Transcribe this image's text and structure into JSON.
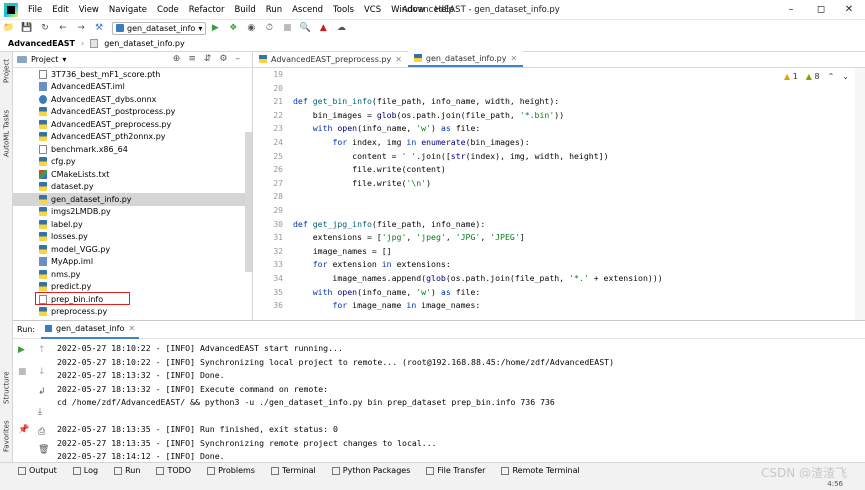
{
  "menu": [
    "File",
    "Edit",
    "View",
    "Navigate",
    "Code",
    "Refactor",
    "Build",
    "Run",
    "Ascend",
    "Tools",
    "VCS",
    "Window",
    "Help"
  ],
  "window_title": "AdvancedEAST - gen_dataset_info.py",
  "toolbar": {
    "run_config": "gen_dataset_info"
  },
  "breadcrumb": {
    "root": "AdvancedEAST",
    "file": "gen_dataset_info.py"
  },
  "left_strip": {
    "project": "Project",
    "automl": "AutoML Tasks",
    "structure": "Structure",
    "favorites": "Favorites"
  },
  "project_panel": {
    "title": "Project",
    "files": [
      {
        "name": "3T736_best_mF1_score.pth",
        "icon": "file"
      },
      {
        "name": "AdvancedEAST.iml",
        "icon": "iml"
      },
      {
        "name": "AdvancedEAST_dybs.onnx",
        "icon": "onnx"
      },
      {
        "name": "AdvancedEAST_postprocess.py",
        "icon": "py"
      },
      {
        "name": "AdvancedEAST_preprocess.py",
        "icon": "py"
      },
      {
        "name": "AdvancedEAST_pth2onnx.py",
        "icon": "py"
      },
      {
        "name": "benchmark.x86_64",
        "icon": "file"
      },
      {
        "name": "cfg.py",
        "icon": "py"
      },
      {
        "name": "CMakeLists.txt",
        "icon": "cmake"
      },
      {
        "name": "dataset.py",
        "icon": "py"
      },
      {
        "name": "gen_dataset_info.py",
        "icon": "py",
        "selected": true
      },
      {
        "name": "imgs2LMDB.py",
        "icon": "py"
      },
      {
        "name": "label.py",
        "icon": "py"
      },
      {
        "name": "losses.py",
        "icon": "py"
      },
      {
        "name": "model_VGG.py",
        "icon": "py"
      },
      {
        "name": "MyApp.iml",
        "icon": "iml"
      },
      {
        "name": "nms.py",
        "icon": "py"
      },
      {
        "name": "predict.py",
        "icon": "py"
      },
      {
        "name": "prep_bin.info",
        "icon": "file",
        "highlighted": true
      },
      {
        "name": "preprocess.py",
        "icon": "py"
      }
    ]
  },
  "editor": {
    "tabs": [
      {
        "label": "AdvancedEAST_preprocess.py",
        "active": false
      },
      {
        "label": "gen_dataset_info.py",
        "active": true
      }
    ],
    "inspections": {
      "warnings": "1",
      "weak_warnings": "8"
    },
    "line_numbers": [
      "19",
      "20",
      "21",
      "22",
      "23",
      "24",
      "25",
      "26",
      "27",
      "28",
      "29",
      "30",
      "31",
      "32",
      "33",
      "34",
      "35",
      "36"
    ],
    "code_lines": [
      "",
      "",
      "def get_bin_info(file_path, info_name, width, height):",
      "    bin_images = glob(os.path.join(file_path, '*.bin'))",
      "    with open(info_name, 'w') as file:",
      "        for index, img in enumerate(bin_images):",
      "            content = ' '.join([str(index), img, width, height])",
      "            file.write(content)",
      "            file.write('\\n')",
      "",
      "",
      "def get_jpg_info(file_path, info_name):",
      "    extensions = ['jpg', 'jpeg', 'JPG', 'JPEG']",
      "    image_names = []",
      "    for extension in extensions:",
      "        image_names.append(glob(os.path.join(file_path, '*.' + extension)))",
      "    with open(info_name, 'w') as file:",
      "        for image_name in image_names:"
    ]
  },
  "run_panel": {
    "label": "Run:",
    "tab": "gen_dataset_info",
    "console": [
      "2022-05-27 18:10:22 - [INFO] AdvancedEAST start running...",
      "2022-05-27 18:10:22 - [INFO] Synchronizing local project to remote... (root@192.168.88.45:/home/zdf/AdvancedEAST)",
      "2022-05-27 18:13:32 - [INFO] Done.",
      "2022-05-27 18:13:32 - [INFO] Execute command on remote:",
      "cd /home/zdf/AdvancedEAST/ && python3 -u ./gen_dataset_info.py bin prep_dataset prep_bin.info 736 736",
      "",
      "2022-05-27 18:13:35 - [INFO] Run finished, exit status: 0",
      "2022-05-27 18:13:35 - [INFO] Synchronizing remote project changes to local...",
      "2022-05-27 18:14:12 - [INFO] Done."
    ]
  },
  "bottom_tools": [
    "Output",
    "Log",
    "Run",
    "TODO",
    "Problems",
    "Terminal",
    "Python Packages",
    "File Transfer",
    "Remote Terminal"
  ],
  "status": {
    "event_log": "Event Log",
    "position": "4:56"
  },
  "watermark": "CSDN @渣渣飞",
  "colors": {
    "accent": "#4083c9",
    "highlight_box": "#e02020",
    "selected_row": "#d5d5d5"
  }
}
